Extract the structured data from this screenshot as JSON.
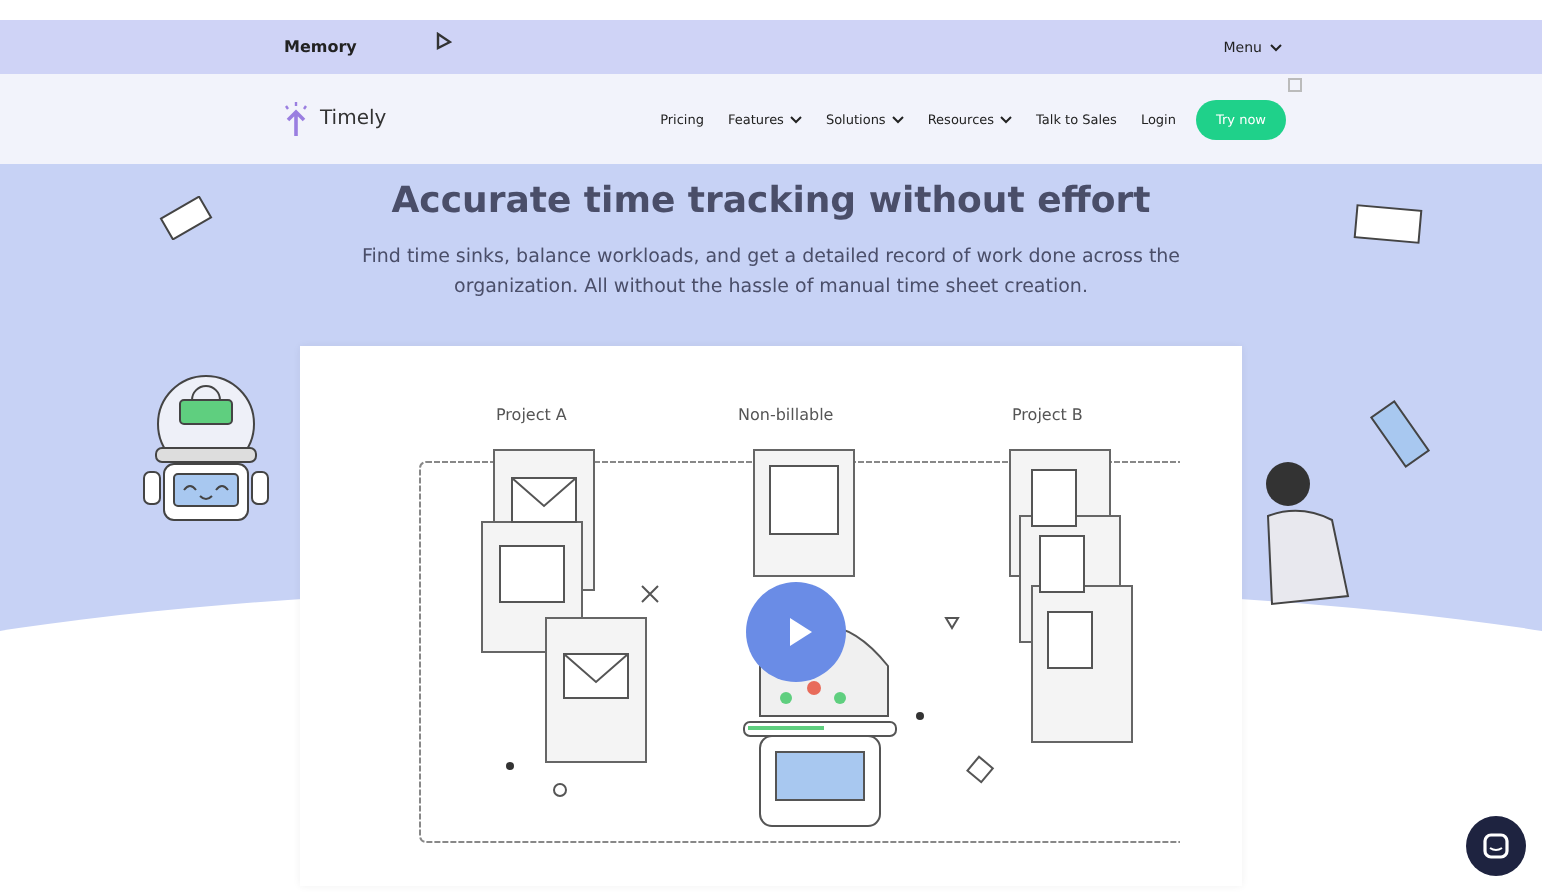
{
  "top_bar": {
    "title": "Memory",
    "menu": "Menu"
  },
  "nav": {
    "brand": "Timely",
    "links": [
      {
        "label": "Pricing",
        "dropdown": false
      },
      {
        "label": "Features",
        "dropdown": true
      },
      {
        "label": "Solutions",
        "dropdown": true
      },
      {
        "label": "Resources",
        "dropdown": true
      },
      {
        "label": "Talk to Sales",
        "dropdown": false
      },
      {
        "label": "Login",
        "dropdown": false
      }
    ],
    "cta": "Try now"
  },
  "hero": {
    "heading": "Accurate time tracking without effort",
    "text": "Find time sinks, balance workloads, and get a detailed record of work done across the organization. All without the hassle of manual time sheet creation."
  },
  "video": {
    "columns": [
      "Project A",
      "Non-billable",
      "Project B"
    ]
  }
}
